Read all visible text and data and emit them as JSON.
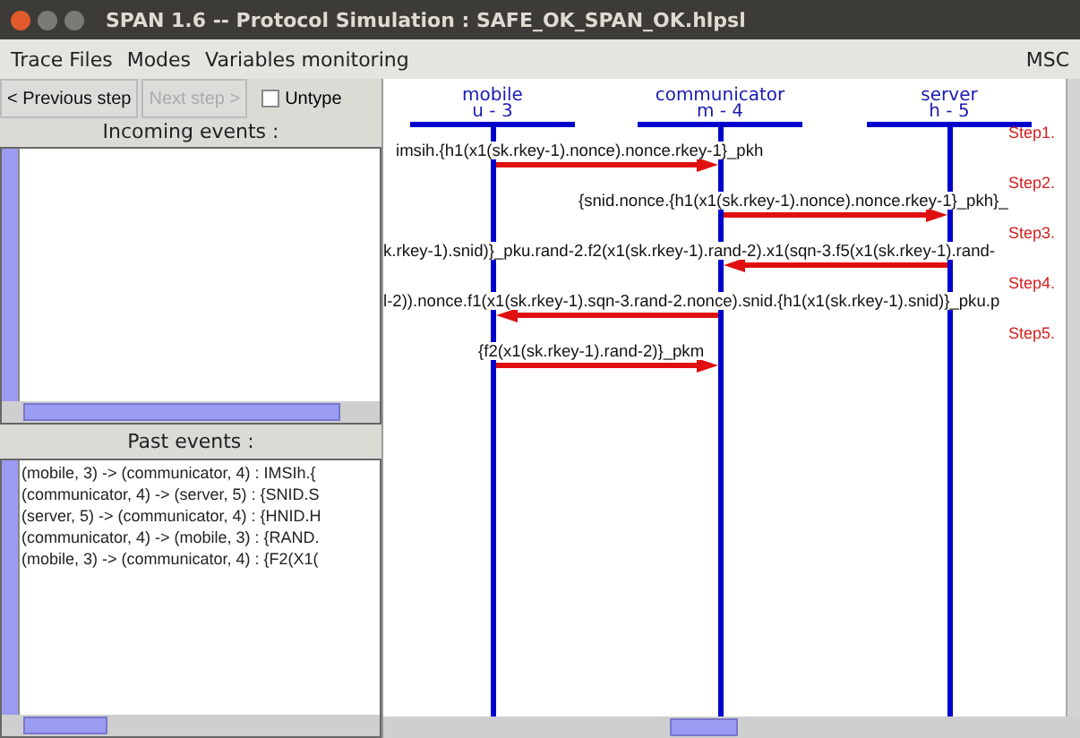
{
  "window": {
    "title": "SPAN 1.6 -- Protocol Simulation : SAFE_OK_SPAN_OK.hlpsl"
  },
  "menu": [
    "Trace Files",
    "Modes",
    "Variables monitoring"
  ],
  "view_label": "MSC",
  "toolbar": {
    "buttons": [
      {
        "label": "< Previous step",
        "disabled": false
      },
      {
        "label": "Next step >",
        "disabled": true
      }
    ],
    "checkbox": {
      "label": "Untype",
      "checked": false
    }
  },
  "incoming_events": {
    "title": "Incoming events :"
  },
  "past_events": {
    "title": "Past events :",
    "items": [
      "(mobile, 3) -> (communicator, 4) : IMSIh.{",
      "(communicator, 4) -> (server, 5) : {SNID.S",
      "(server, 5) -> (communicator, 4) : {HNID.H",
      "(communicator, 4) -> (mobile, 3) : {RAND.",
      "(mobile, 3) -> (communicator, 4) : {F2(X1("
    ]
  },
  "msc": {
    "agents": [
      {
        "name": "mobile",
        "id": "u - 3"
      },
      {
        "name": "communicator",
        "id": "m - 4"
      },
      {
        "name": "server",
        "id": "h - 5"
      }
    ],
    "messages": [
      {
        "step": "Step1.",
        "text": "imsih.{h1(x1(sk.rkey-1).nonce).nonce.rkey-1}_pkh"
      },
      {
        "step": "Step2.",
        "text": "{snid.nonce.{h1(x1(sk.rkey-1).nonce).nonce.rkey-1}_pkh}_"
      },
      {
        "step": "Step3.",
        "text": "k.rkey-1).snid)}_pku.rand-2.f2(x1(sk.rkey-1).rand-2).x1(sqn-3.f5(x1(sk.rkey-1).rand-"
      },
      {
        "step": "Step4.",
        "text": "l-2)).nonce.f1(x1(sk.rkey-1).sqn-3.rand-2.nonce).snid.{h1(x1(sk.rkey-1).snid)}_pku.p"
      },
      {
        "step": "Step5.",
        "text": "{f2(x1(sk.rkey-1).rand-2)}_pkm"
      }
    ]
  }
}
